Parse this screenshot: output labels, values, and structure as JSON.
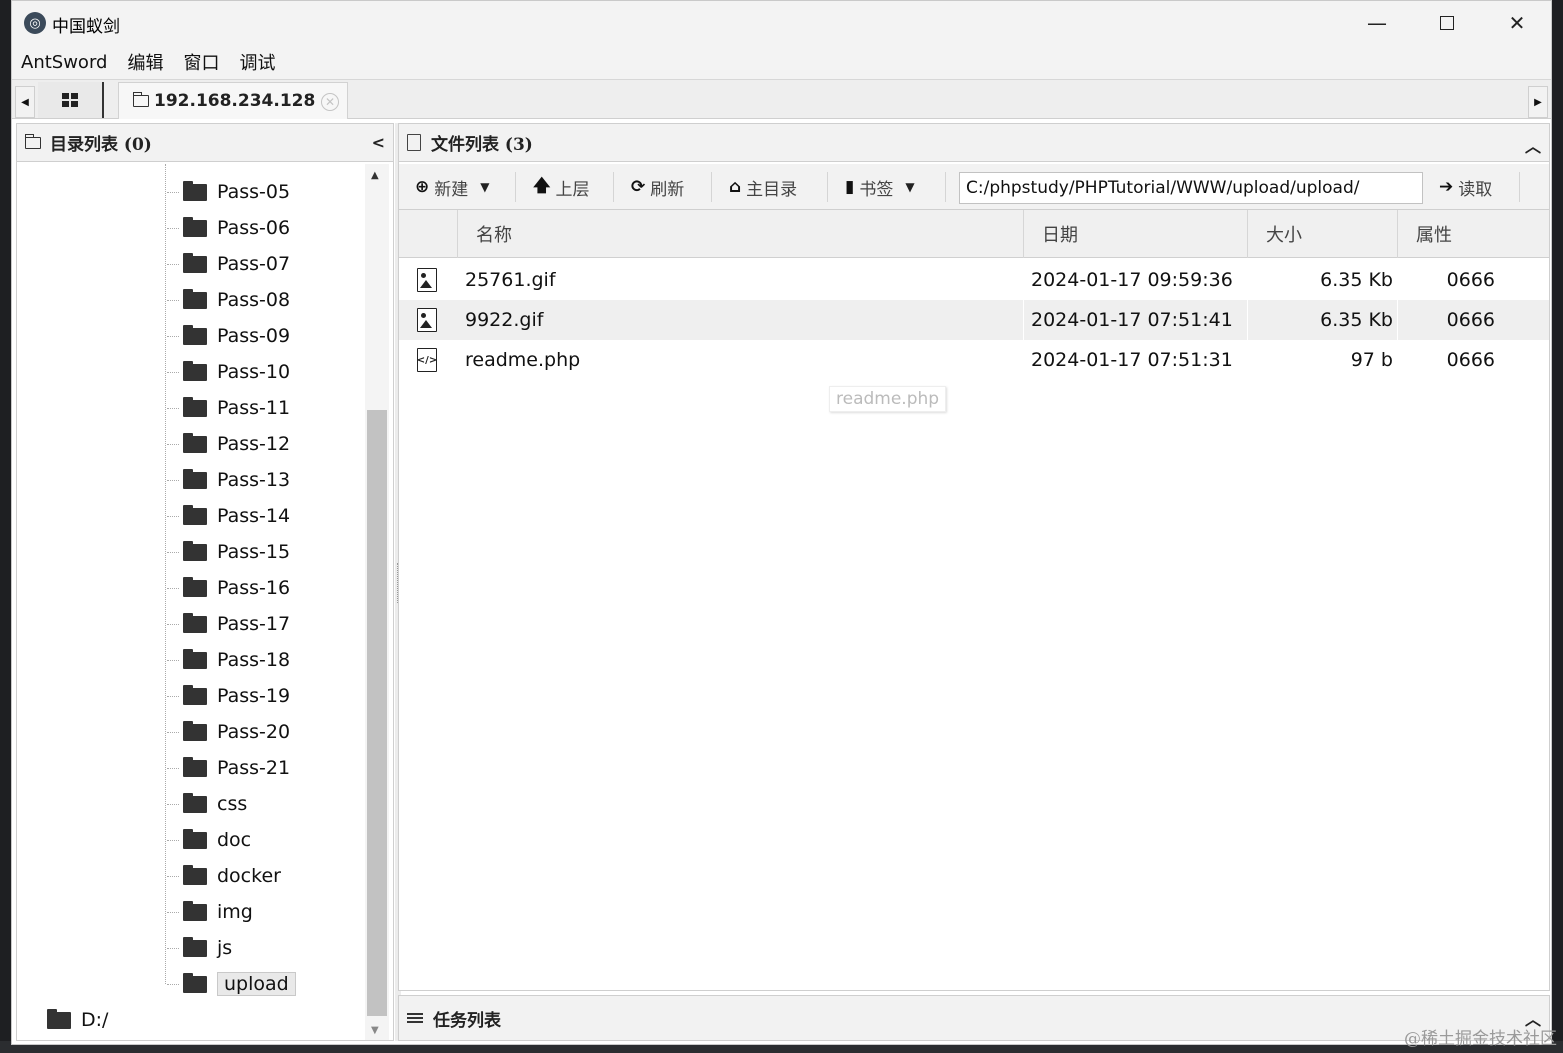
{
  "window": {
    "title": "中国蚁剑",
    "icon_name": "antsword-logo-icon"
  },
  "menu": [
    "AntSword",
    "编辑",
    "窗口",
    "调试"
  ],
  "tabs": {
    "host_label": "192.168.234.128"
  },
  "dir_panel": {
    "title": "目录列表 (0)",
    "folders": [
      "Pass-05",
      "Pass-06",
      "Pass-07",
      "Pass-08",
      "Pass-09",
      "Pass-10",
      "Pass-11",
      "Pass-12",
      "Pass-13",
      "Pass-14",
      "Pass-15",
      "Pass-16",
      "Pass-17",
      "Pass-18",
      "Pass-19",
      "Pass-20",
      "Pass-21",
      "css",
      "doc",
      "docker",
      "img",
      "js",
      "upload"
    ],
    "selected": "upload",
    "root": "D:/"
  },
  "file_panel": {
    "title": "文件列表 (3)",
    "toolbar": {
      "new_label": "新建",
      "up_label": "上层",
      "refresh_label": "刷新",
      "home_label": "主目录",
      "bookmark_label": "书签",
      "path_value": "C:/phpstudy/PHPTutorial/WWW/upload/upload/",
      "read_label": "读取"
    },
    "columns": [
      "名称",
      "日期",
      "大小",
      "属性"
    ],
    "files": [
      {
        "name": "25761.gif",
        "date": "2024-01-17 09:59:36",
        "size": "6.35 Kb",
        "attr": "0666",
        "type": "image"
      },
      {
        "name": "9922.gif",
        "date": "2024-01-17 07:51:41",
        "size": "6.35 Kb",
        "attr": "0666",
        "type": "image"
      },
      {
        "name": "readme.php",
        "date": "2024-01-17 07:51:31",
        "size": "97 b",
        "attr": "0666",
        "type": "code"
      }
    ],
    "tooltip": "readme.php"
  },
  "task_panel": {
    "title": "任务列表"
  },
  "watermark": "@稀土掘金技术社区"
}
